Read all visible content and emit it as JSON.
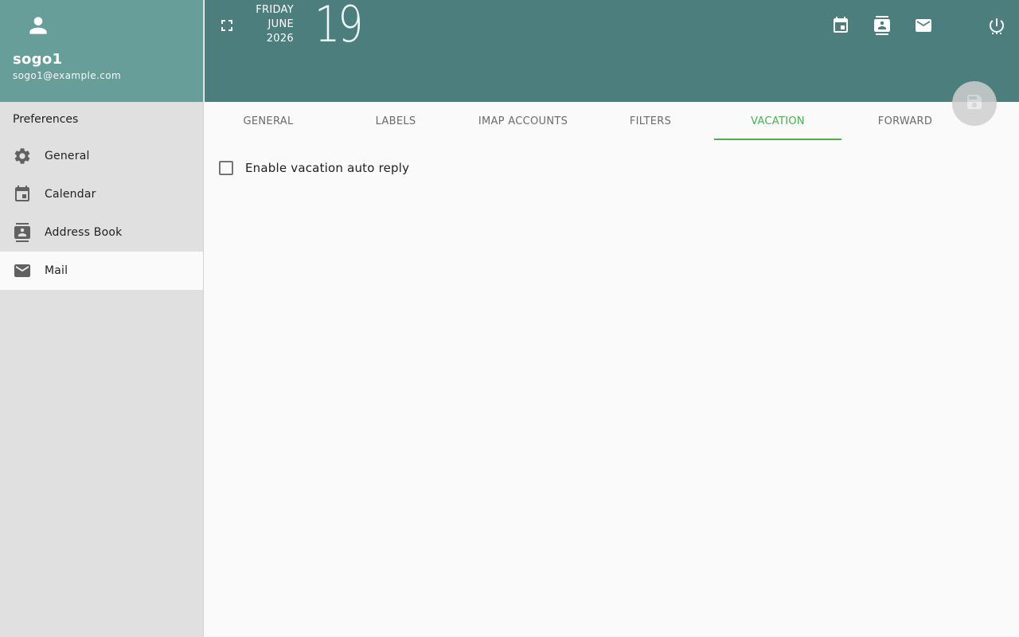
{
  "user": {
    "name": "sogo1",
    "email": "sogo1@example.com"
  },
  "sidebar": {
    "section_title": "Preferences",
    "items": [
      {
        "label": "General",
        "icon": "gear-icon"
      },
      {
        "label": "Calendar",
        "icon": "calendar-icon"
      },
      {
        "label": "Address Book",
        "icon": "contacts-icon"
      },
      {
        "label": "Mail",
        "icon": "mail-icon",
        "active": true
      }
    ]
  },
  "header": {
    "weekday": "FRIDAY",
    "month": "JUNE",
    "year": "2026",
    "day": "19",
    "icons": [
      "fullscreen-icon",
      "calendar-icon",
      "contacts-icon",
      "mail-icon",
      "power-icon",
      "save-icon"
    ]
  },
  "tabs": [
    {
      "label": "GENERAL"
    },
    {
      "label": "LABELS"
    },
    {
      "label": "IMAP ACCOUNTS"
    },
    {
      "label": "FILTERS"
    },
    {
      "label": "VACATION",
      "active": true
    },
    {
      "label": "FORWARD"
    }
  ],
  "vacation": {
    "enable_label": "Enable vacation auto reply",
    "enabled": false
  },
  "colors": {
    "sidebar_header": "#679e99",
    "topbar": "#4d7e7e",
    "sidebar_bg": "#e0e0e0",
    "active_tab": "#4caf50"
  }
}
